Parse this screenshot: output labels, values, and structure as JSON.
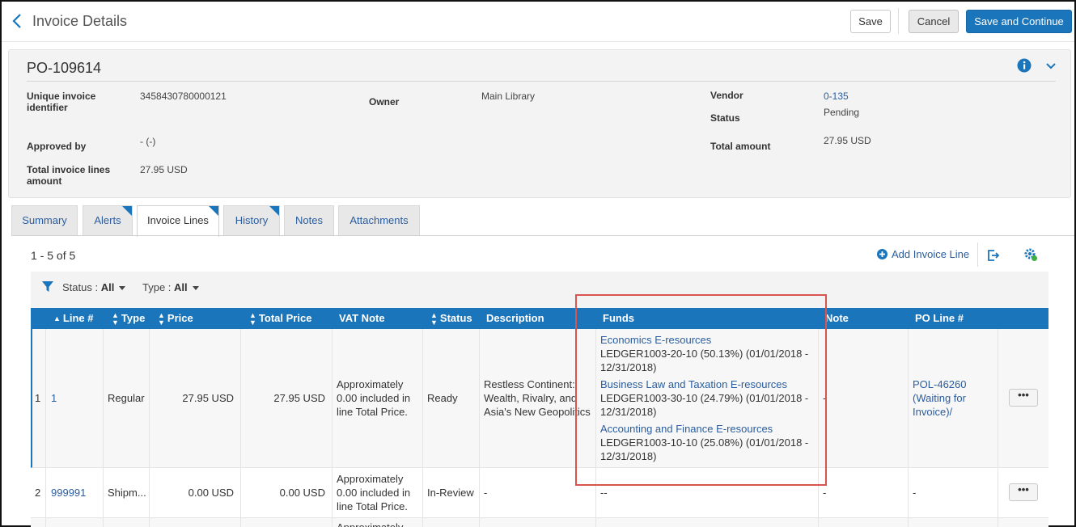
{
  "header": {
    "title": "Invoice Details",
    "save_label": "Save",
    "cancel_label": "Cancel",
    "save_continue_label": "Save and Continue"
  },
  "summary": {
    "po_number": "PO-109614",
    "unique_id_label_1": "Unique invoice",
    "unique_id_label_2": "identifier",
    "unique_id_value": "3458430780000121",
    "owner_label": "Owner",
    "owner_value": "Main Library",
    "vendor_label": "Vendor",
    "vendor_value": "0-135",
    "status_label": "Status",
    "status_value": "Pending",
    "approved_by_label": "Approved by",
    "approved_by_value": "- (-)",
    "total_amount_label": "Total amount",
    "total_amount_value": "27.95 USD",
    "total_lines_label_1": "Total invoice lines",
    "total_lines_label_2": "amount",
    "total_lines_value": "27.95 USD"
  },
  "tabs": [
    {
      "label": "Summary"
    },
    {
      "label": "Alerts"
    },
    {
      "label": "Invoice Lines"
    },
    {
      "label": "History"
    },
    {
      "label": "Notes"
    },
    {
      "label": "Attachments"
    }
  ],
  "list": {
    "count": "1 - 5 of 5",
    "add_label": "Add Invoice Line",
    "filters": {
      "status_label": "Status :",
      "status_value": "All",
      "type_label": "Type :",
      "type_value": "All"
    }
  },
  "table": {
    "columns": {
      "line": "Line #",
      "type": "Type",
      "price": "Price",
      "total_price": "Total Price",
      "vat_note": "VAT Note",
      "status": "Status",
      "description": "Description",
      "funds": "Funds",
      "note": "Note",
      "po_line": "PO Line #"
    },
    "rows": [
      {
        "index": "1",
        "line": "1",
        "type": "Regular",
        "price": "27.95 USD",
        "total_price": "27.95 USD",
        "vat_note": [
          "Approximately",
          "0.00 included in",
          "line Total Price."
        ],
        "status": "Ready",
        "description": [
          "Restless Continent:",
          "Wealth, Rivalry, and",
          "Asia's New Geopolitics"
        ],
        "funds": [
          {
            "name": "Economics E-resources",
            "detail1": "LEDGER1003-20-10 (50.13%) (01/01/2018 -",
            "detail2": "12/31/2018)"
          },
          {
            "name": "Business Law and Taxation E-resources",
            "detail1": "LEDGER1003-30-10 (24.79%) (01/01/2018 -",
            "detail2": "12/31/2018)"
          },
          {
            "name": "Accounting and Finance E-resources",
            "detail1": "LEDGER1003-10-10 (25.08%) (01/01/2018 -",
            "detail2": "12/31/2018)"
          }
        ],
        "note": "-",
        "po_line": [
          "POL-46260",
          "(Waiting for",
          "Invoice)/"
        ],
        "more": "•••"
      },
      {
        "index": "2",
        "line": "999991",
        "type": "Shipm...",
        "price": "0.00 USD",
        "total_price": "0.00 USD",
        "vat_note": [
          "Approximately",
          "0.00 included in",
          "line Total Price."
        ],
        "status": "In-Review",
        "description": [
          "-"
        ],
        "funds_text": "--",
        "note": "-",
        "po_line": [
          "-"
        ],
        "more": "•••"
      },
      {
        "vat_note": [
          "Approximately"
        ]
      }
    ]
  }
}
